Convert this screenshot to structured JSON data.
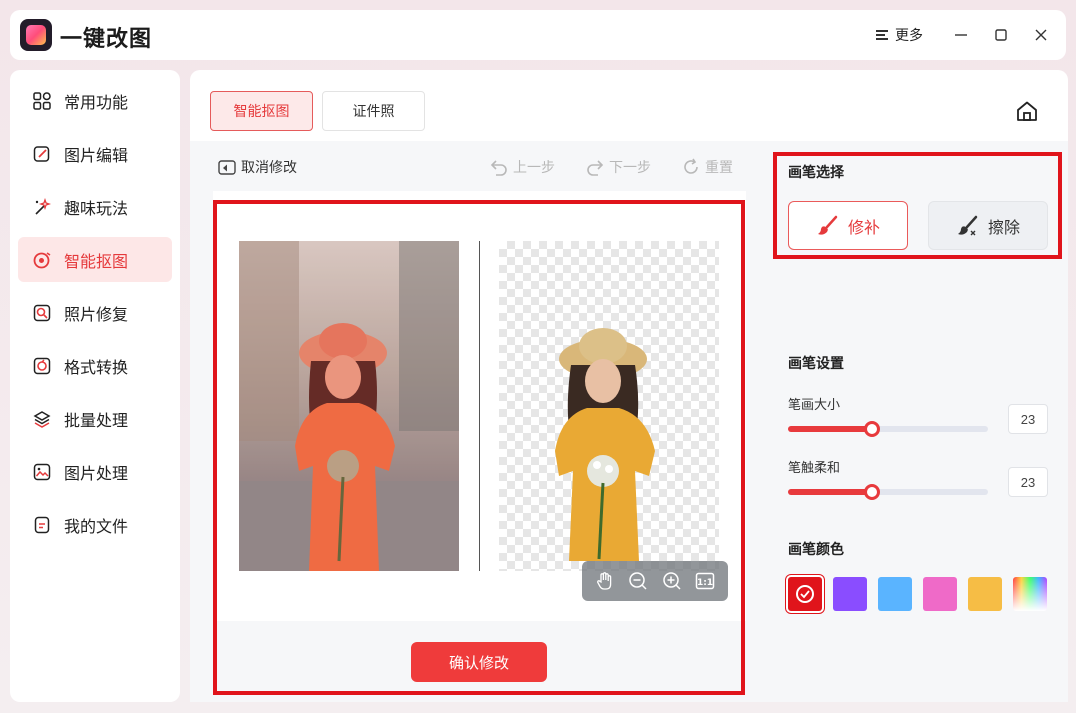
{
  "app": {
    "title": "一键改图",
    "more_label": "更多"
  },
  "sidebar": {
    "items": [
      {
        "label": "常用功能",
        "icon": "grid-icon"
      },
      {
        "label": "图片编辑",
        "icon": "edit-icon"
      },
      {
        "label": "趣味玩法",
        "icon": "magic-wand-icon"
      },
      {
        "label": "智能抠图",
        "icon": "cutout-icon",
        "active": true
      },
      {
        "label": "照片修复",
        "icon": "photo-repair-icon"
      },
      {
        "label": "格式转换",
        "icon": "format-convert-icon"
      },
      {
        "label": "批量处理",
        "icon": "layers-icon"
      },
      {
        "label": "图片处理",
        "icon": "image-icon"
      },
      {
        "label": "我的文件",
        "icon": "file-icon"
      }
    ]
  },
  "tabs": [
    {
      "label": "智能抠图",
      "active": true
    },
    {
      "label": "证件照"
    }
  ],
  "toolbar": {
    "cancel": "取消修改",
    "undo": "上一步",
    "redo": "下一步",
    "reset": "重置"
  },
  "confirm_label": "确认修改",
  "brush": {
    "section_title": "画笔选择",
    "repair_label": "修补",
    "erase_label": "擦除",
    "settings_title": "画笔设置",
    "size_label": "笔画大小",
    "size_value": "23",
    "size_level": 0.42,
    "softness_label": "笔触柔和",
    "softness_value": "23",
    "softness_level": 0.42,
    "color_title": "画笔颜色",
    "colors": [
      "#e0141b",
      "#8a4dff",
      "#5ab4ff",
      "#ef6ac8",
      "#f6bd45",
      "rainbow"
    ]
  }
}
